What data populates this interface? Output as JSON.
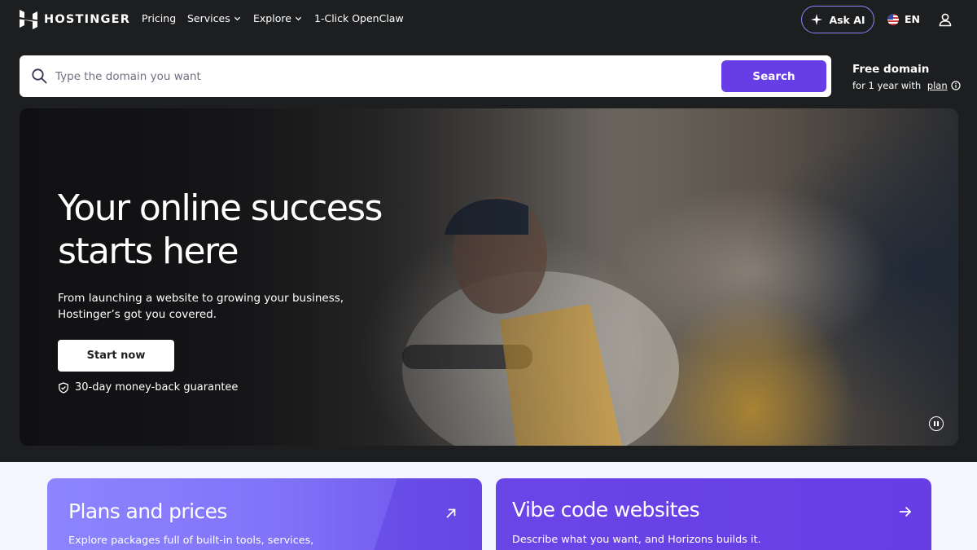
{
  "brand": {
    "name": "HOSTINGER"
  },
  "nav": {
    "pricing": "Pricing",
    "services": "Services",
    "explore": "Explore",
    "openclaw": "1-Click OpenClaw",
    "ask_ai": "Ask AI",
    "language": "EN"
  },
  "search": {
    "placeholder": "Type the domain you want",
    "button": "Search"
  },
  "free_domain": {
    "title": "Free domain",
    "sub_prefix": "for 1 year with ",
    "sub_link": "plan"
  },
  "hero": {
    "title": "Your online success starts here",
    "subtitle": "From launching a website to growing your business, Hostinger’s got you covered.",
    "cta": "Start now",
    "guarantee": "30-day money-back guarantee"
  },
  "cards": [
    {
      "title": "Plans and prices",
      "description": "Explore packages full of built-in tools, services,"
    },
    {
      "title": "Vibe code websites",
      "description": "Describe what you want, and Horizons builds it."
    }
  ],
  "colors": {
    "accent": "#673de6",
    "accent_light": "#8c85ff",
    "background_dark": "#1d1e20",
    "section_light": "#f4f5ff"
  },
  "icons": {
    "logo": "hostinger-logo-icon",
    "chevron": "chevron-down-icon",
    "ask_ai": "sparkle-icon",
    "flag": "us-flag-icon",
    "user": "user-icon",
    "search": "search-icon",
    "info": "info-icon",
    "shield": "shield-check-icon",
    "pause": "pause-icon",
    "arrow_diag": "arrow-up-right-icon",
    "arrow_right": "arrow-right-icon"
  }
}
